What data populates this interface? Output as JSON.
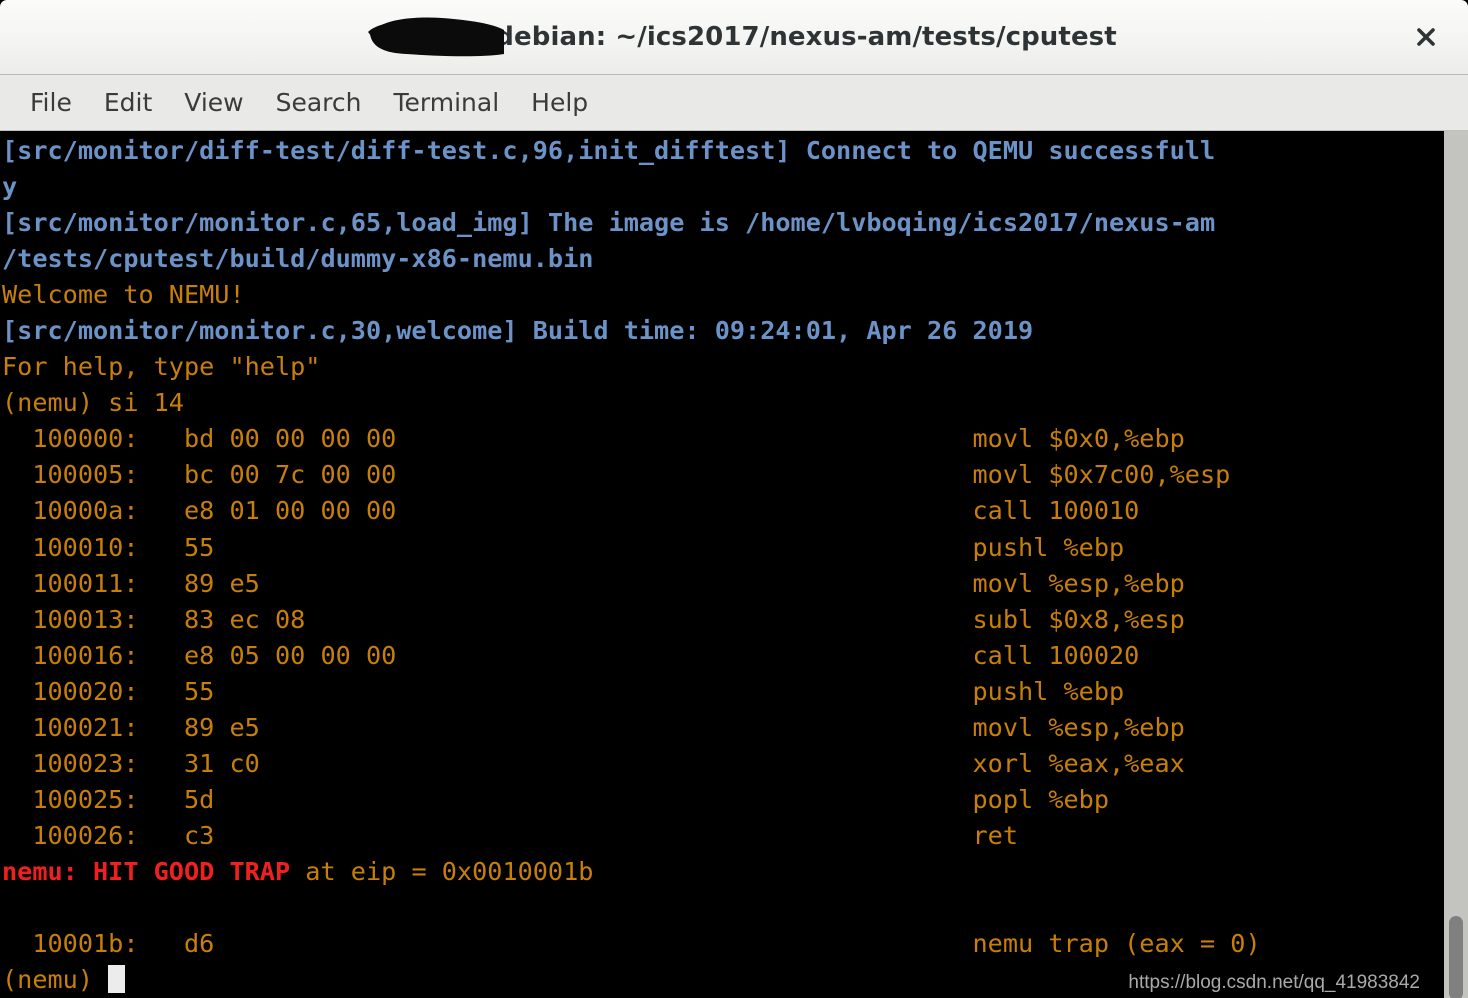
{
  "window": {
    "title": "@debian: ~/ics2017/nexus-am/tests/cputest",
    "close_label": "✕",
    "redaction_note": "username blacked out"
  },
  "menubar": {
    "items": [
      {
        "label": "File"
      },
      {
        "label": "Edit"
      },
      {
        "label": "View"
      },
      {
        "label": "Search"
      },
      {
        "label": "Terminal"
      },
      {
        "label": "Help"
      }
    ]
  },
  "colors": {
    "background": "#000000",
    "log_blue": "#6b93c8",
    "output_orange": "#c87f0a",
    "trap_red": "#f02020",
    "cursor": "#ececec",
    "titlebar": "#f4f4f2",
    "menubar": "#e9e9e7",
    "scrollbar_track": "#c3c3c0",
    "scrollbar_thumb": "#808080"
  },
  "terminal": {
    "prompt": "(nemu)",
    "command": "si 14",
    "lines": [
      {
        "segments": [
          {
            "text": "[src/monitor/diff-test/diff-test.c,96,init_difftest] Connect to QEMU successfull",
            "color": "blue"
          }
        ]
      },
      {
        "segments": [
          {
            "text": "y",
            "color": "blue"
          }
        ]
      },
      {
        "segments": [
          {
            "text": "[src/monitor/monitor.c,65,load_img] The image is /home/lvboqing/ics2017/nexus-am",
            "color": "blue"
          }
        ]
      },
      {
        "segments": [
          {
            "text": "/tests/cputest/build/dummy-x86-nemu.bin",
            "color": "blue"
          }
        ]
      },
      {
        "segments": [
          {
            "text": "Welcome to NEMU!",
            "color": "orange"
          }
        ]
      },
      {
        "segments": [
          {
            "text": "[src/monitor/monitor.c,30,welcome] Build time: 09:24:01, Apr 26 2019",
            "color": "blue"
          }
        ]
      },
      {
        "segments": [
          {
            "text": "For help, type \"help\"",
            "color": "orange"
          }
        ]
      },
      {
        "segments": [
          {
            "text": "(nemu) si 14",
            "color": "orange"
          }
        ]
      },
      {
        "segments": [
          {
            "text": "  100000:   bd 00 00 00 00                                      movl $0x0,%ebp",
            "color": "orange"
          }
        ]
      },
      {
        "segments": [
          {
            "text": "  100005:   bc 00 7c 00 00                                      movl $0x7c00,%esp",
            "color": "orange"
          }
        ]
      },
      {
        "segments": [
          {
            "text": "  10000a:   e8 01 00 00 00                                      call 100010",
            "color": "orange"
          }
        ]
      },
      {
        "segments": [
          {
            "text": "  100010:   55                                                  pushl %ebp",
            "color": "orange"
          }
        ]
      },
      {
        "segments": [
          {
            "text": "  100011:   89 e5                                               movl %esp,%ebp",
            "color": "orange"
          }
        ]
      },
      {
        "segments": [
          {
            "text": "  100013:   83 ec 08                                            subl $0x8,%esp",
            "color": "orange"
          }
        ]
      },
      {
        "segments": [
          {
            "text": "  100016:   e8 05 00 00 00                                      call 100020",
            "color": "orange"
          }
        ]
      },
      {
        "segments": [
          {
            "text": "  100020:   55                                                  pushl %ebp",
            "color": "orange"
          }
        ]
      },
      {
        "segments": [
          {
            "text": "  100021:   89 e5                                               movl %esp,%ebp",
            "color": "orange"
          }
        ]
      },
      {
        "segments": [
          {
            "text": "  100023:   31 c0                                               xorl %eax,%eax",
            "color": "orange"
          }
        ]
      },
      {
        "segments": [
          {
            "text": "  100025:   5d                                                  popl %ebp",
            "color": "orange"
          }
        ]
      },
      {
        "segments": [
          {
            "text": "  100026:   c3                                                  ret",
            "color": "orange"
          }
        ]
      },
      {
        "segments": [
          {
            "text": "nemu: HIT GOOD TRAP",
            "color": "red"
          },
          {
            "text": " at eip = 0x0010001b",
            "color": "orange"
          }
        ]
      },
      {
        "segments": [
          {
            "text": "",
            "color": "orange"
          }
        ]
      },
      {
        "segments": [
          {
            "text": "  10001b:   d6                                                  nemu trap (eax = 0)",
            "color": "orange"
          }
        ]
      }
    ],
    "last_prompt": "(nemu) ",
    "instructions": [
      {
        "address": "100000",
        "bytes": "bd 00 00 00 00",
        "asm": "movl $0x0,%ebp"
      },
      {
        "address": "100005",
        "bytes": "bc 00 7c 00 00",
        "asm": "movl $0x7c00,%esp"
      },
      {
        "address": "10000a",
        "bytes": "e8 01 00 00 00",
        "asm": "call 100010"
      },
      {
        "address": "100010",
        "bytes": "55",
        "asm": "pushl %ebp"
      },
      {
        "address": "100011",
        "bytes": "89 e5",
        "asm": "movl %esp,%ebp"
      },
      {
        "address": "100013",
        "bytes": "83 ec 08",
        "asm": "subl $0x8,%esp"
      },
      {
        "address": "100016",
        "bytes": "e8 05 00 00 00",
        "asm": "call 100020"
      },
      {
        "address": "100020",
        "bytes": "55",
        "asm": "pushl %ebp"
      },
      {
        "address": "100021",
        "bytes": "89 e5",
        "asm": "movl %esp,%ebp"
      },
      {
        "address": "100023",
        "bytes": "31 c0",
        "asm": "xorl %eax,%eax"
      },
      {
        "address": "100025",
        "bytes": "5d",
        "asm": "popl %ebp"
      },
      {
        "address": "100026",
        "bytes": "c3",
        "asm": "ret"
      },
      {
        "address": "10001b",
        "bytes": "d6",
        "asm": "nemu trap (eax = 0)"
      }
    ],
    "trap_message": "nemu: HIT GOOD TRAP at eip = 0x0010001b"
  },
  "watermark": {
    "text": "https://blog.csdn.net/qq_41983842"
  }
}
